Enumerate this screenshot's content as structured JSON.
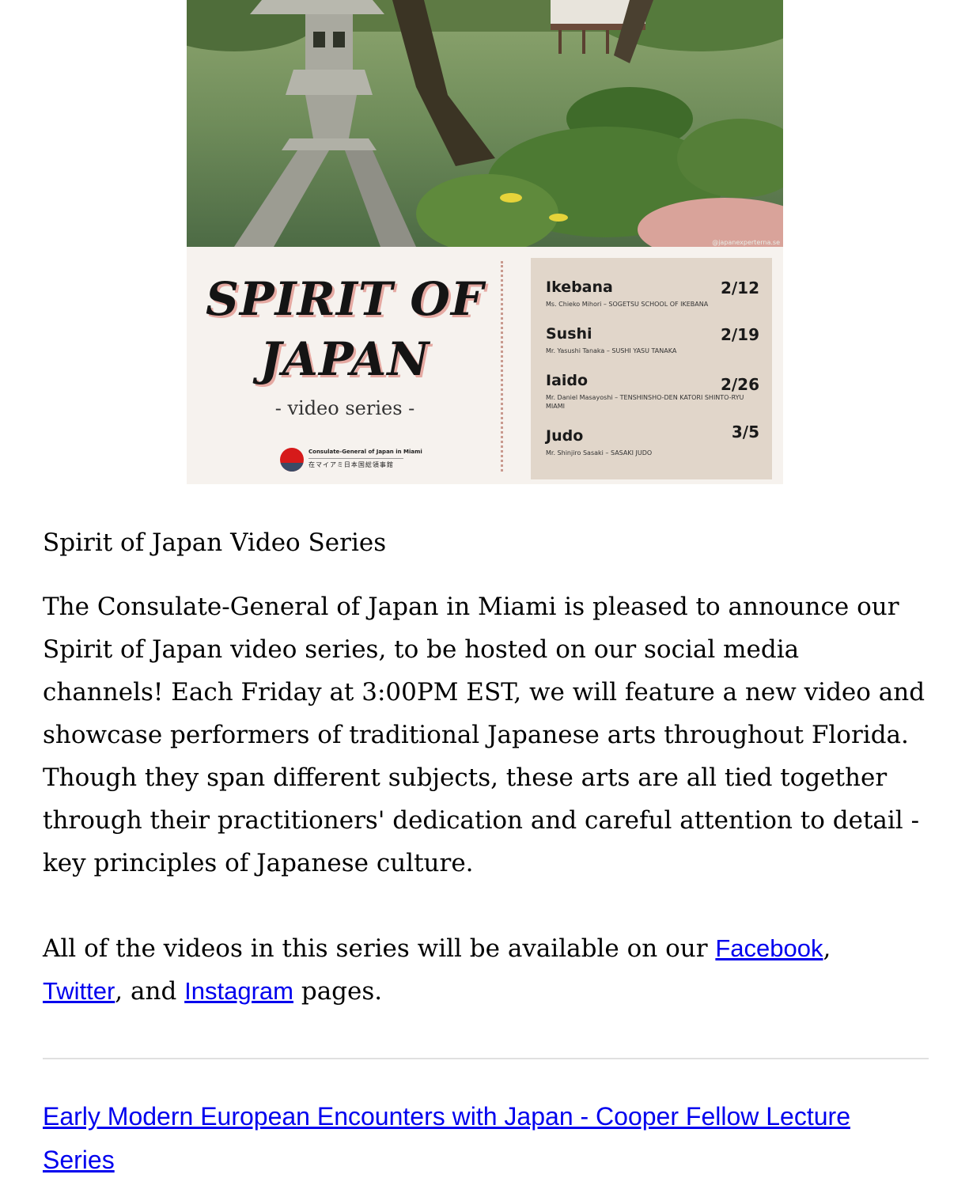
{
  "poster": {
    "photo_credit": "@japanexperterna.se",
    "title_line1": "SPIRIT OF",
    "title_line2": "JAPAN",
    "subtitle": "- video series -",
    "logo_en": "Consulate-General of Japan in Miami",
    "logo_jp": "在マイアミ日本国総領事館",
    "schedule": [
      {
        "name": "Ikebana",
        "date": "2/12",
        "by": "Ms. Chieko Mihori – SOGETSU SCHOOL OF IKEBANA"
      },
      {
        "name": "Sushi",
        "date": "2/19",
        "by": "Mr. Yasushi Tanaka – SUSHI YASU TANAKA"
      },
      {
        "name": "Iaido",
        "date": "2/26",
        "by": "Mr. Daniel Masayoshi – TENSHINSHO-DEN KATORI SHINTO-RYU MIAMI"
      },
      {
        "name": "Judo",
        "date": "3/5",
        "by": "Mr. Shinjiro Sasaki – SASAKI JUDO"
      }
    ]
  },
  "article": {
    "title": "Spirit of Japan Video Series",
    "body": "The Consulate-General of Japan in Miami is pleased to announce our Spirit of Japan video series, to be hosted on our social media channels! Each Friday at 3:00PM EST, we will feature a new video and showcase performers of traditional Japanese arts throughout Florida. Though they span different subjects, these arts are all tied together through their practitioners' dedication and careful attention to detail - key principles of Japanese culture.",
    "links_prefix": "All of the videos in this series will be available on our ",
    "facebook": "Facebook",
    "comma": ",",
    "twitter": "Twitter",
    "and": ", and ",
    "instagram": "Instagram",
    "links_suffix": " pages."
  },
  "next_article": {
    "title": "Early Modern European Encounters with Japan - Cooper Fellow Lecture Series"
  },
  "colors": {
    "link": "#0000ee",
    "poster_bg": "#f6f2ee",
    "schedule_bg": "#e1d6ca",
    "title_shadow": "#e5a9a2"
  }
}
